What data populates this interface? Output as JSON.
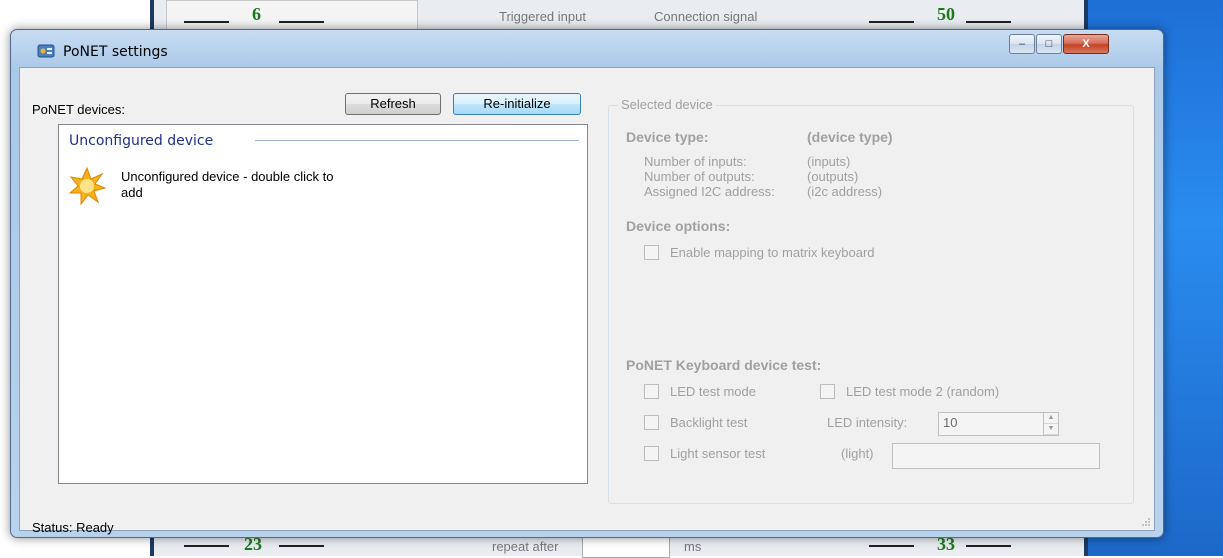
{
  "background_app": {
    "numbers": [
      "6",
      "50",
      "23",
      "33"
    ],
    "top_labels": [
      "Triggered input",
      "Connection signal"
    ],
    "bottom_labels": [
      "repeat after",
      "ms"
    ]
  },
  "window": {
    "title": "PoNET settings",
    "controls": {
      "minimize": "–",
      "maximize": "□",
      "close": "X"
    }
  },
  "devices": {
    "label": "PoNET devices:",
    "refresh_label": "Refresh",
    "reinit_label": "Re-initialize",
    "group_header": "Unconfigured device",
    "items": [
      {
        "label": "Unconfigured device - double click to add",
        "icon": "starburst-icon"
      }
    ]
  },
  "status": {
    "text": "Status: Ready"
  },
  "selected_device": {
    "title": "Selected device",
    "device_type_label": "Device type:",
    "device_type_value": "(device type)",
    "inputs_label": "Number of inputs:",
    "inputs_value": "(inputs)",
    "outputs_label": "Number of outputs:",
    "outputs_value": "(outputs)",
    "i2c_label": "Assigned I2C address:",
    "i2c_value": "(i2c address)",
    "options_label": "Device options:",
    "matrix_label": "Enable mapping to matrix keyboard",
    "test_label": "PoNET Keyboard device test:",
    "led_test_label": "LED test mode",
    "led_test2_label": "LED test mode 2 (random)",
    "backlight_label": "Backlight test",
    "led_intensity_label": "LED intensity:",
    "led_intensity_value": "10",
    "light_sensor_label": "Light sensor test",
    "light_label": "(light)",
    "light_value": ""
  },
  "colors": {
    "group_header": "#1e3287",
    "disabled_text": "#a0a0a0",
    "background_number": "#1a7a1a"
  }
}
